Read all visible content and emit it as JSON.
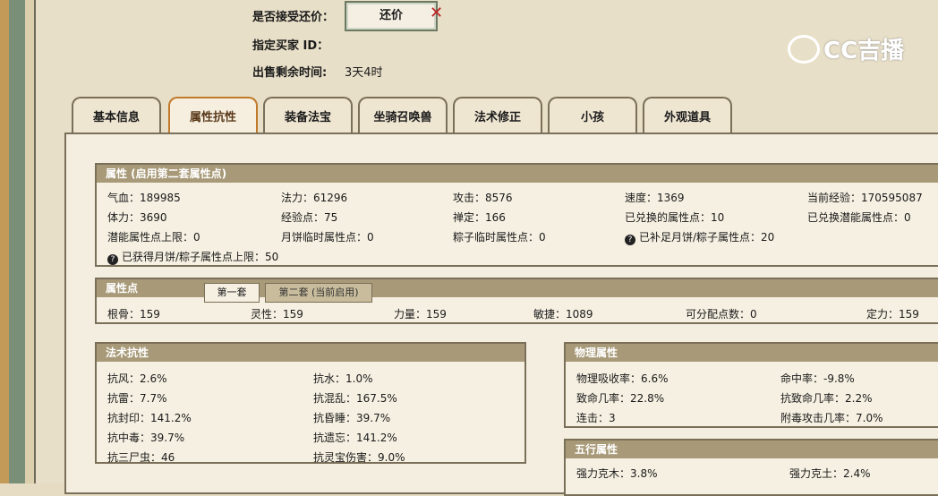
{
  "header": {
    "accept_counter_label": "是否接受还价：",
    "counter_button": "还价",
    "designated_buyer_label": "指定买家 ID：",
    "designated_buyer_value": "",
    "remaining_time_label": "出售剩余时间:",
    "remaining_time_value": "3天4时"
  },
  "logo": {
    "text": "CC吉播"
  },
  "tabs": [
    "基本信息",
    "属性抗性",
    "装备法宝",
    "坐骑召唤兽",
    "法术修正",
    "小孩",
    "外观道具"
  ],
  "attributes": {
    "title": "属性 (启用第二套属性点)",
    "row1": [
      "气血：189985",
      "法力：61296",
      "攻击：8576",
      "速度：1369",
      "当前经验：170595087"
    ],
    "row2": [
      "体力：3690",
      "经验点：75",
      "禅定：166",
      "已兑换的属性点：10",
      "已兑换潜能属性点：0"
    ],
    "row3": [
      "潜能属性点上限：0",
      "月饼临时属性点：0",
      "粽子临时属性点：0",
      "已补足月饼/粽子属性点：20"
    ],
    "row4": [
      "已获得月饼/粽子属性点上限：50"
    ]
  },
  "attr_points": {
    "title": "属性点",
    "subtab1": "第一套",
    "subtab2": "第二套 (当前启用)",
    "values": [
      "根骨：159",
      "灵性：159",
      "力量：159",
      "敏捷：1089",
      "可分配点数：0",
      "定力：159"
    ]
  },
  "spell_resist": {
    "title": "法术抗性",
    "left": [
      "抗风：2.6%",
      "抗雷：7.7%",
      "抗封印：141.2%",
      "抗中毒：39.7%",
      "抗三尸虫：46"
    ],
    "right": [
      "抗水：1.0%",
      "抗混乱：167.5%",
      "抗昏睡：39.7%",
      "抗遗忘：141.2%",
      "抗灵宝伤害：9.0%"
    ]
  },
  "physical": {
    "title": "物理属性",
    "left": [
      "物理吸收率：6.6%",
      "致命几率：22.8%",
      "连击：3"
    ],
    "right": [
      "命中率：-9.8%",
      "抗致命几率：2.2%",
      "附毒攻击几率：7.0%"
    ]
  },
  "five_elements": {
    "title": "五行属性",
    "left": [
      "强力克木：3.8%"
    ],
    "right": [
      "强力克土：2.4%"
    ]
  }
}
